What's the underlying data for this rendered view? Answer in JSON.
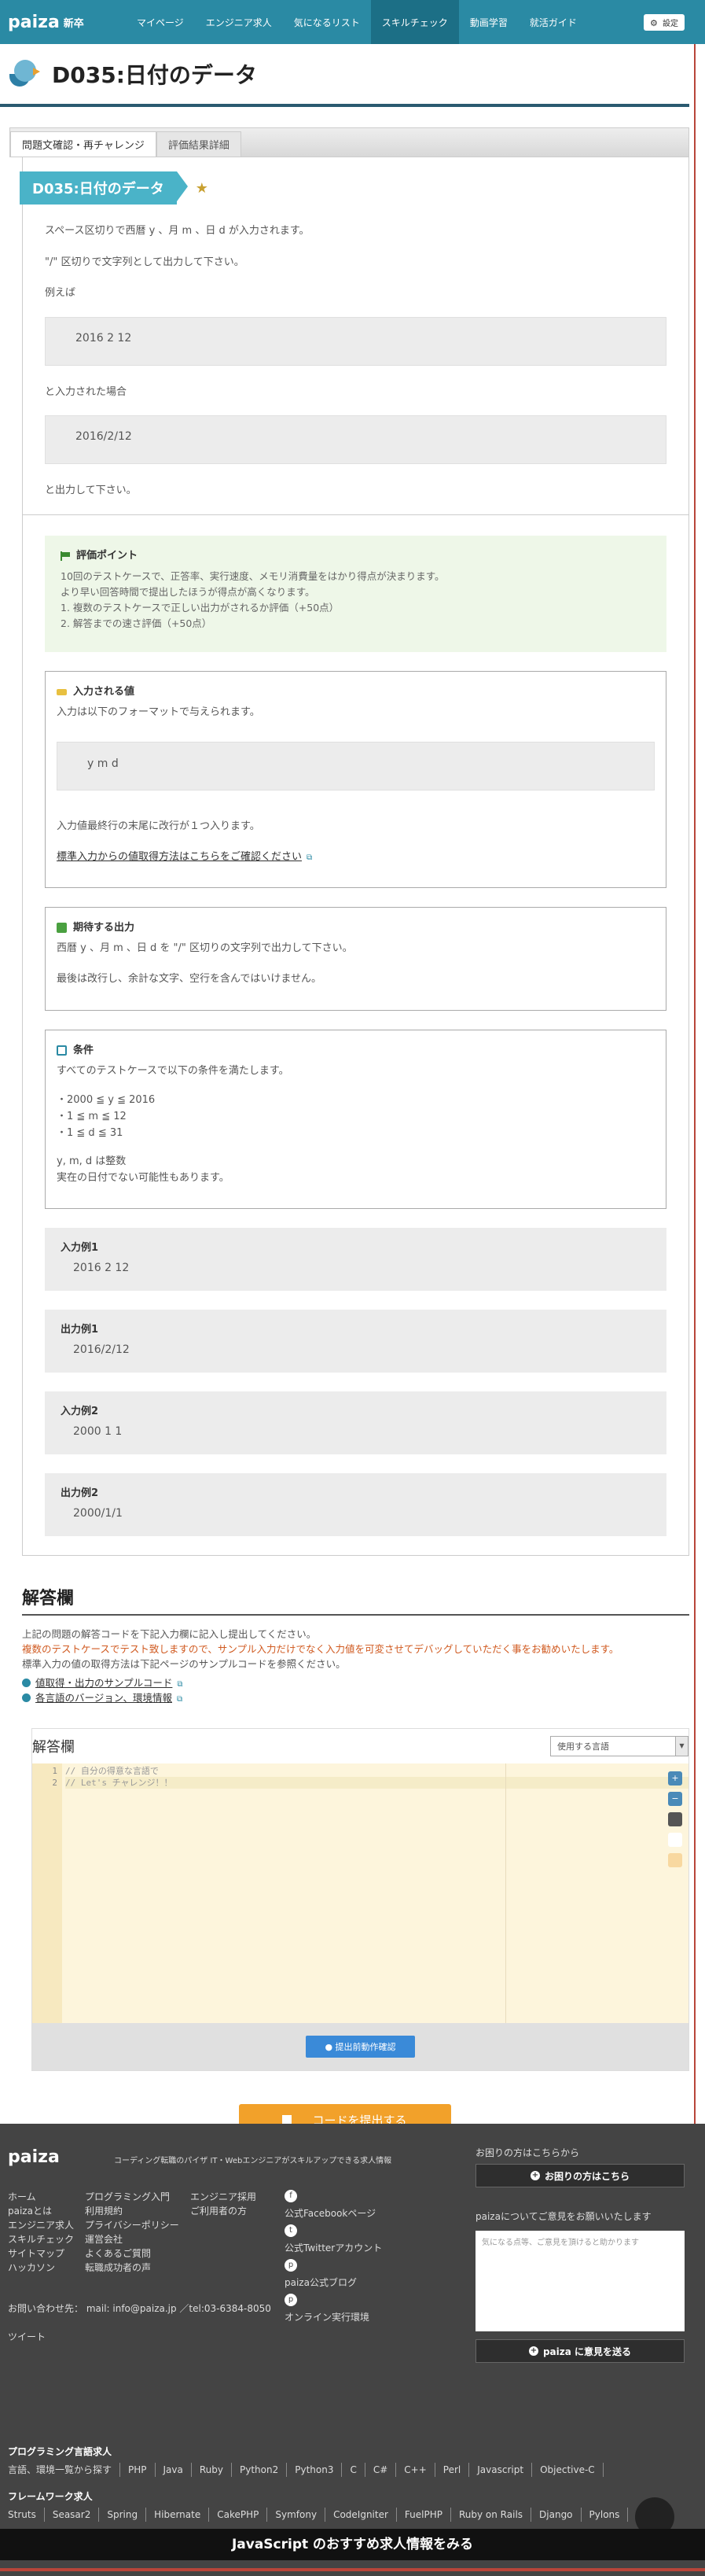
{
  "header": {
    "logo": "paiza",
    "logo_sub": "新卒",
    "nav": [
      "マイページ",
      "エンジニア求人",
      "気になるリスト",
      "スキルチェック",
      "動画学習",
      "就活ガイド"
    ],
    "active_nav": 3,
    "settings": "設定"
  },
  "title": "D035:日付のデータ",
  "tabs": [
    "問題文確認・再チャレンジ",
    "評価結果詳細"
  ],
  "problem": {
    "ribbon": "D035:日付のデータ",
    "line1": "スペース区切りで西暦 y 、月 m 、日 d が入力されます。",
    "line2": "\"/\" 区切りで文字列として出力して下さい。",
    "example_label": "例えば",
    "example_input": "2016 2 12",
    "input_note": "と入力された場合",
    "example_output": "2016/2/12",
    "output_note": "と出力して下さい。"
  },
  "score": {
    "title": "評価ポイント",
    "lines": [
      "10回のテストケースで、正答率、実行速度、メモリ消費量をはかり得点が決まります。",
      "より早い回答時間で提出したほうが得点が高くなります。",
      "1.  複数のテストケースで正しい出力がされるか評価（+50点）",
      "2.  解答までの速さ評価（+50点）"
    ]
  },
  "input_spec": {
    "title": "入力される値",
    "desc": "入力は以下のフォーマットで与えられます。",
    "format": "y m d",
    "note": "入力値最終行の末尾に改行が１つ入ります。",
    "link": "標準入力からの値取得方法はこちらをご確認ください"
  },
  "output_spec": {
    "title": "期待する出力",
    "line1": "西暦 y 、月 m 、日 d を \"/\" 区切りの文字列で出力して下さい。",
    "line2": "最後は改行し、余計な文字、空行を含んではいけません。"
  },
  "conditions": {
    "title": "条件",
    "desc": "すべてのテストケースで以下の条件を満たします。",
    "items": [
      "・2000 ≦ y ≦ 2016",
      "・1 ≦ m ≦ 12",
      "・1 ≦ d ≦ 31"
    ],
    "note1": "y, m, d は整数",
    "note2": "実在の日付でない可能性もあります。"
  },
  "examples": [
    {
      "title": "入力例1",
      "value": "2016 2 12"
    },
    {
      "title": "出力例1",
      "value": "2016/2/12"
    },
    {
      "title": "入力例2",
      "value": "2000 1 1"
    },
    {
      "title": "出力例2",
      "value": "2000/1/1"
    }
  ],
  "answer": {
    "title": "解答欄",
    "desc1": "上記の問題の解答コードを下記入力欄に記入し提出してください。",
    "warn": "複数のテストケースでテスト致しますので、サンプル入力だけでなく入力値を可変させてデバッグしていただく事をお勧めいたします。",
    "desc2": "標準入力の値の取得方法は下記ページのサンプルコードを参照ください。",
    "link1": "値取得・出力のサンプルコード",
    "link2": "各言語のバージョン、環境情報",
    "editor_title": "解答欄",
    "lang_placeholder": "使用する言語",
    "code_lines": [
      "// 自分の得意な言語で",
      "// Let's チャレンジ！！"
    ],
    "line_numbers": [
      "1",
      "2"
    ],
    "test_button": "提出前動作確認",
    "submit_button": "コードを提出する"
  },
  "footer": {
    "logo": "paiza",
    "tagline": "コーディング転職のパイザ  IT・Webエンジニアがスキルアップできる求人情報",
    "col1": [
      "ホーム",
      "paizaとは",
      "エンジニア求人",
      "スキルチェック",
      "サイトマップ",
      "ハッカソン"
    ],
    "col2": [
      "プログラミング入門",
      "利用規約",
      "プライバシーポリシー",
      "運営会社",
      "よくあるご質問",
      "転職成功者の声"
    ],
    "col3": [
      "エンジニア採用",
      "ご利用者の方"
    ],
    "social": [
      "公式Facebookページ",
      "公式Twitterアカウント",
      "paiza公式ブログ",
      "オンライン実行環境"
    ],
    "contact": "お問い合わせ先：  mail: info@paiza.jp ／tel:03-6384-8050",
    "tweet": "ツイート",
    "help_label": "お困りの方はこちらから",
    "help_button": "お困りの方はこちら",
    "feedback_label": "paizaについてご意見をお願いいたします",
    "feedback_placeholder": "気になる点等、ご意見を頂けると助かります",
    "feedback_button": "paiza に意見を送る",
    "lang_heading": "プログラミング言語求人",
    "langs": [
      "言語、環境一覧から探す",
      "PHP",
      "Java",
      "Ruby",
      "Python2",
      "Python3",
      "C",
      "C#",
      "C++",
      "Perl",
      "Javascript",
      "Objective-C"
    ],
    "fw_heading": "フレームワーク求人",
    "frameworks": [
      "Struts",
      "Seasar2",
      "Spring",
      "Hibernate",
      "CakePHP",
      "Symfony",
      "CodeIgniter",
      "FuelPHP",
      "Ruby on Rails",
      "Django",
      "Pylons"
    ],
    "banner": "JavaScript のおすすめ求人情報をみる"
  }
}
